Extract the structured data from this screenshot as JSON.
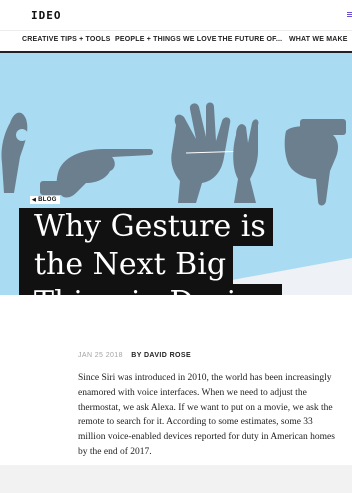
{
  "header": {
    "logo": "IDEO",
    "menu_icon": "menu-icon"
  },
  "nav": {
    "items": [
      "CREATIVE TIPS + TOOLS",
      "PEOPLE + THINGS WE LOVE",
      "THE FUTURE OF...",
      "WHAT WE MAKE"
    ]
  },
  "hero": {
    "background_color": "#a9dbf3",
    "image_content": "hand-gestures-illustration"
  },
  "article": {
    "back_label": "BLOG",
    "back_icon": "triangle-left-icon",
    "title_lines": [
      "Why Gesture is",
      "the Next Big",
      "Thing in Design"
    ],
    "date": "JAN 25 2018",
    "byline": "BY DAVID ROSE",
    "body_lines": [
      "Since Siri was introduced in 2010, the world has been increasingly",
      "enamored with voice interfaces. When we need to adjust the",
      "thermostat, we ask Alexa. If we want to put on a movie, we ask the",
      "remote to search for it. According to some estimates, some 33",
      "million voice-enabled devices reported for duty in American homes",
      "by the end of 2017."
    ]
  },
  "colors": {
    "accent": "#6a4fd6",
    "title_bg": "#111111",
    "title_text": "#ffffff"
  }
}
